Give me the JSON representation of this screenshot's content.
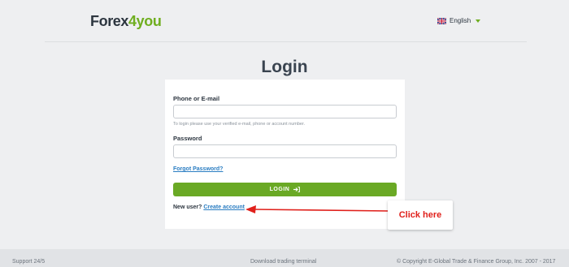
{
  "header": {
    "logo_forex": "Forex",
    "logo_four": "4",
    "logo_you": "you",
    "language": "English",
    "flag_icon": "uk-flag-icon",
    "caret_icon": "caret-down-icon"
  },
  "login_form": {
    "title": "Login",
    "phone_label": "Phone or E-mail",
    "phone_value": "",
    "phone_hint": "To login please use your verified e-mail, phone or account number.",
    "password_label": "Password",
    "password_value": "",
    "forgot_link": "Forgot Password?",
    "login_button": "LOGIN",
    "login_icon": "sign-in-icon",
    "new_user_text": "New user?",
    "create_account_link": "Create account"
  },
  "annotation": {
    "callout_text": "Click here",
    "arrow_color": "#e0201b"
  },
  "footer": {
    "support": "Support 24/5",
    "download": "Download trading terminal",
    "copyright": "© Copyright E-Global Trade & Finance Group, Inc. 2007 - 2017"
  },
  "colors": {
    "brand_green": "#6aa925",
    "link_blue": "#2a7dc2",
    "background": "#eeeff1"
  }
}
